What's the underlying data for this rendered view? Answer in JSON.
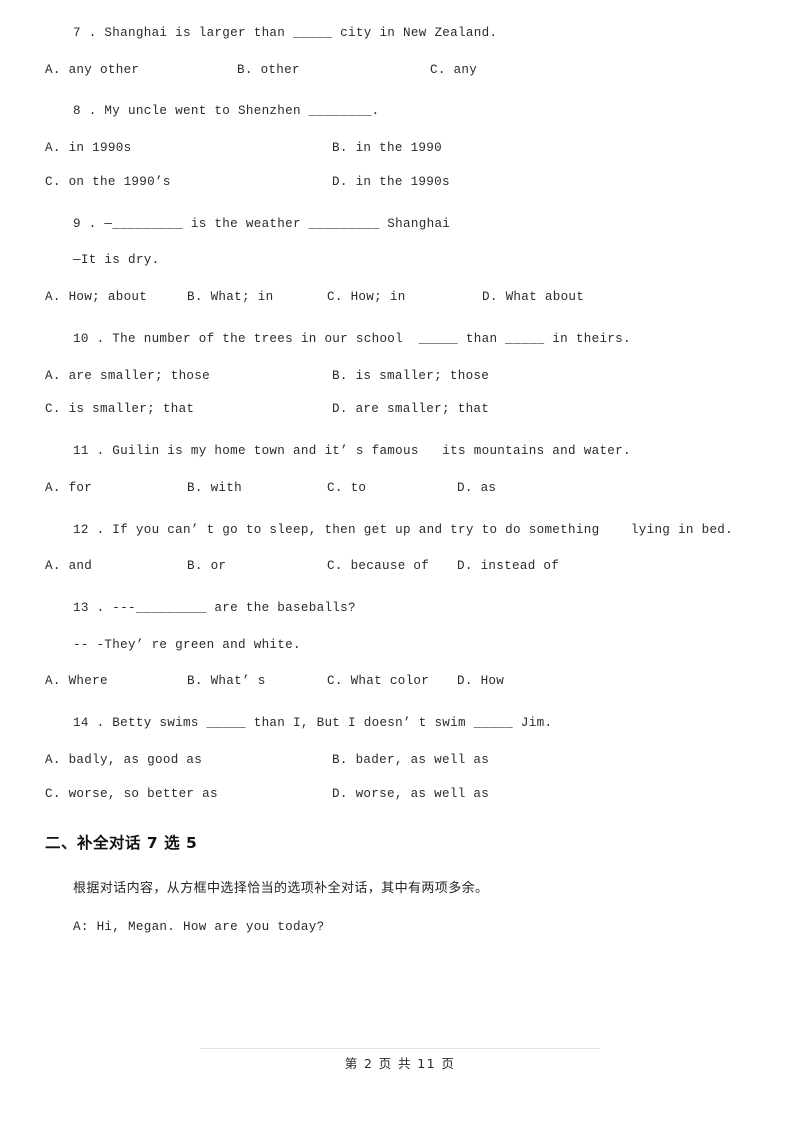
{
  "document": {
    "page_label": "第 2 页 共 11 页"
  },
  "questions": [
    {
      "stem": "7 . Shanghai is larger than _____ city in New Zealand.",
      "layout": "cols-3",
      "options": [
        "A. any other",
        "B. other",
        "C. any"
      ]
    },
    {
      "stem": "8 . My uncle went to Shenzhen ________.",
      "layout": "cols-2",
      "options_row1": [
        "A. in 1990s",
        "B. in the 1990"
      ],
      "options_row2": [
        "C. on the 1990’s",
        "D. in the 1990s"
      ]
    },
    {
      "stem": "9 . —_________ is the weather _________ Shanghai",
      "stem2": "—It is dry.",
      "layout": "cols-4a",
      "options": [
        "A. How; about",
        "B. What; in",
        "C. How; in",
        "D. What about"
      ]
    },
    {
      "stem": "10 . The number of the trees in our school  _____ than _____ in theirs.",
      "layout": "cols-2",
      "options_row1": [
        "A. are smaller; those",
        "B. is smaller; those"
      ],
      "options_row2": [
        "C. is smaller; that",
        "D. are smaller; that"
      ]
    },
    {
      "stem": "11 . Guilin is my home town and it’ s famous   its mountains and water.",
      "layout": "cols-4b",
      "options": [
        "A. for",
        "B. with",
        "C. to",
        "D. as"
      ]
    },
    {
      "stem": "12 . If you can’ t go to sleep, then get up and try to do something    lying in bed.",
      "layout": "cols-4b",
      "options": [
        "A. and",
        "B. or",
        "C. because of",
        "D. instead of"
      ]
    },
    {
      "stem": "13 . ---_________ are the baseballs?",
      "stem2": "-- -They’ re green and white.",
      "layout": "cols-4b",
      "options": [
        "A. Where",
        "B. What’ s",
        "C. What color",
        "D. How"
      ]
    },
    {
      "stem": "14 . Betty swims _____ than I, But I doesn’ t swim _____ Jim.",
      "layout": "cols-2",
      "options_row1": [
        "A. badly, as good as",
        "B. bader, as well as"
      ],
      "options_row2": [
        "C. worse, so better as",
        "D. worse, as well as"
      ]
    }
  ],
  "section_two": {
    "heading": "二、补全对话 7 选 5",
    "instruction": "根据对话内容，从方框中选择恰当的选项补全对话，其中有两项多余。",
    "dialog_line_1": "A: Hi, Megan. How are you today?"
  }
}
